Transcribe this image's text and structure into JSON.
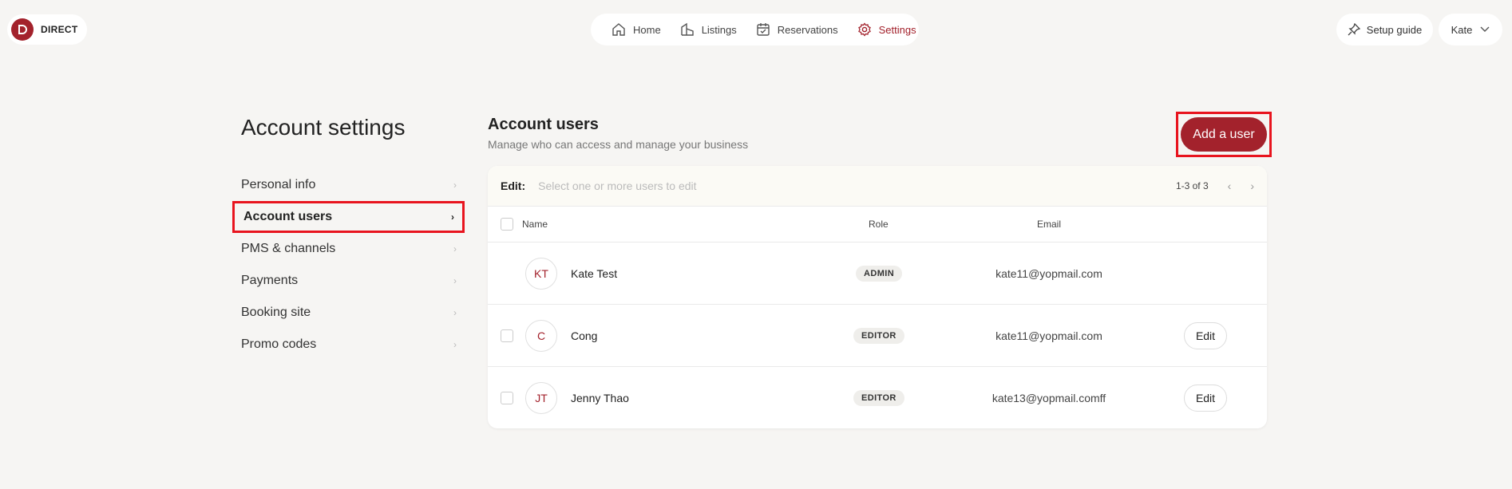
{
  "brand": {
    "name": "DIRECT",
    "color": "#a3222c"
  },
  "topnav": {
    "items": [
      {
        "label": "Home",
        "icon": "home-icon"
      },
      {
        "label": "Listings",
        "icon": "listings-icon"
      },
      {
        "label": "Reservations",
        "icon": "calendar-icon"
      },
      {
        "label": "Settings",
        "icon": "gear-icon",
        "active": true
      }
    ]
  },
  "header_right": {
    "setup_label": "Setup guide",
    "user_label": "Kate"
  },
  "page": {
    "title": "Account settings"
  },
  "sidebar": {
    "items": [
      {
        "label": "Personal info"
      },
      {
        "label": "Account users",
        "active": true
      },
      {
        "label": "PMS & channels"
      },
      {
        "label": "Payments"
      },
      {
        "label": "Booking site"
      },
      {
        "label": "Promo codes"
      }
    ]
  },
  "main": {
    "title": "Account users",
    "subtitle": "Manage who can access and manage your business",
    "add_button": "Add a user"
  },
  "table": {
    "edit_label": "Edit:",
    "edit_placeholder": "Select one or more users to edit",
    "pagination": "1-3 of 3",
    "columns": [
      "Name",
      "Role",
      "Email"
    ],
    "row_edit_label": "Edit",
    "rows": [
      {
        "initials": "KT",
        "name": "Kate Test",
        "role": "ADMIN",
        "email": "kate11@yopmail.com"
      },
      {
        "initials": "C",
        "name": "Cong",
        "role": "EDITOR",
        "email": "kate11@yopmail.com"
      },
      {
        "initials": "JT",
        "name": "Jenny Thao",
        "role": "EDITOR",
        "email": "kate13@yopmail.comff"
      }
    ]
  }
}
